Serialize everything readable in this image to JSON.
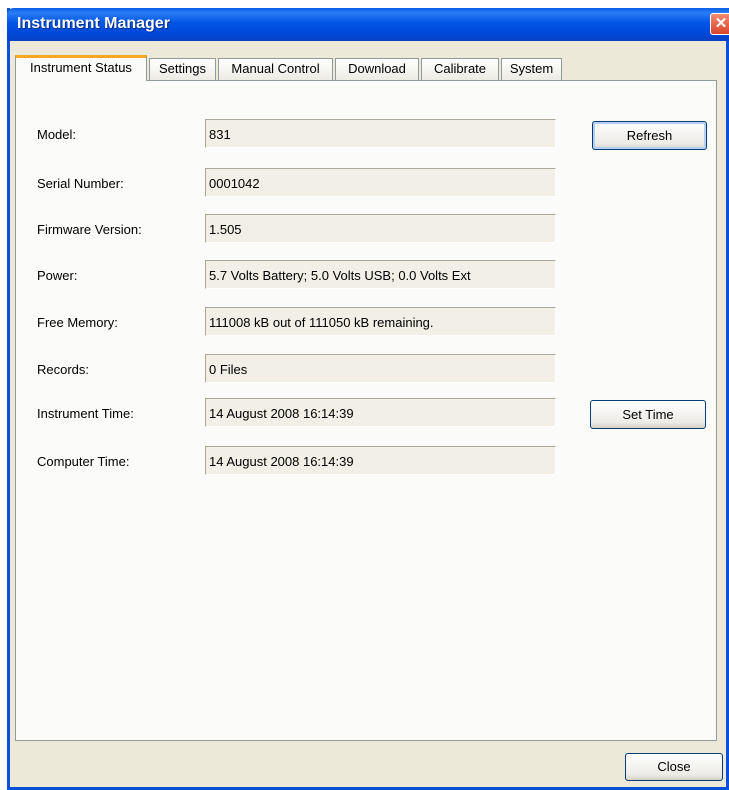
{
  "window": {
    "title": "Instrument Manager",
    "close_glyph": "✕"
  },
  "tabs": [
    "Instrument Status",
    "Settings",
    "Manual Control",
    "Download",
    "Calibrate",
    "System"
  ],
  "fields": {
    "model": {
      "label": "Model:",
      "value": "831"
    },
    "serial": {
      "label": "Serial Number:",
      "value": "0001042"
    },
    "firmware": {
      "label": "Firmware Version:",
      "value": "1.505"
    },
    "power": {
      "label": "Power:",
      "value": "5.7 Volts Battery; 5.0 Volts USB; 0.0 Volts Ext"
    },
    "memory": {
      "label": "Free Memory:",
      "value": "111008 kB out of 111050 kB remaining."
    },
    "records": {
      "label": "Records:",
      "value": "0 Files"
    },
    "instrument_time": {
      "label": "Instrument Time:",
      "value": "14 August 2008 16:14:39"
    },
    "computer_time": {
      "label": "Computer Time:",
      "value": "14 August 2008 16:14:39"
    }
  },
  "buttons": {
    "refresh": "Refresh",
    "set_time": "Set Time",
    "close": "Close"
  },
  "colors": {
    "titlebar": "#0055e5",
    "active_tab_accent": "#f5a623",
    "window_bg": "#ece9d8"
  }
}
